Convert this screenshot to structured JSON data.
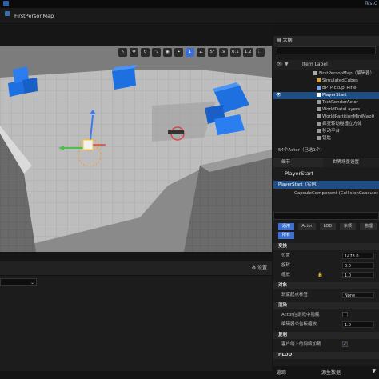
{
  "titlebar": {
    "app_right": "TestC"
  },
  "map_tab": {
    "label": "FirstPersonMap"
  },
  "viewport": {
    "toolbar": {
      "snap_angle": "5°",
      "snap_scale": "0.1",
      "speed": "1.2",
      "grid": "1"
    }
  },
  "bottom_panel": {
    "settings_label": "设置"
  },
  "outliner": {
    "title": "大纲",
    "search_placeholder": "",
    "column_label": "Item Label",
    "sort_arrow": "▼",
    "rows": [
      {
        "label": "FirstPersonMap（编辑器）",
        "indent": 0
      },
      {
        "label": "SimulatedCubes",
        "indent": 1
      },
      {
        "label": "BP_Pickup_Rifle",
        "indent": 1
      },
      {
        "label": "PlayerStart",
        "indent": 1,
        "selected": true
      },
      {
        "label": "TextRenderActor",
        "indent": 1
      },
      {
        "label": "WorldDataLayers",
        "indent": 1
      },
      {
        "label": "WorldPartitionMiniMap0",
        "indent": 1
      },
      {
        "label": "疯狂转动碰撞立方体",
        "indent": 1
      },
      {
        "label": "移动平台",
        "indent": 1
      },
      {
        "label": "钥匙",
        "indent": 1
      }
    ],
    "count": "54个Actor（已选1个）"
  },
  "details": {
    "tab_details": "细节",
    "tab_world": "世界场景设置",
    "actor_name": "PlayerStart",
    "component_root": "PlayerStart（实例）",
    "component_child": "CapsuleComponent (CollisionCapsule)",
    "filters": [
      "通用",
      "Actor",
      "LOD",
      "杂项",
      "物理"
    ],
    "filter_all": "所有",
    "sections": {
      "transform": "变换",
      "location": "位置",
      "rotation": "旋转",
      "scale": "缩放",
      "location_val": "1478.0",
      "rotation_val": "0.0",
      "scale_val": "1.0",
      "object": "对象",
      "player_start_tag": "玩家起点标签",
      "player_start_value": "None",
      "render": "渲染",
      "actor_hidden": "Actor在游戏中隐藏",
      "billboard_scale": "编辑器公告板缩放",
      "billboard_value": "1.0",
      "replication": "复制",
      "net_load": "客户端上的网络加载",
      "hlod": "HLOD"
    }
  },
  "statusbar": {
    "track": "追踪",
    "add_data": "源生数据",
    "cmd": "▼"
  },
  "colors": {
    "accent": "#3b6fd6",
    "selected_row": "#1f4e86",
    "cube_blue": "#1e6fe0"
  }
}
